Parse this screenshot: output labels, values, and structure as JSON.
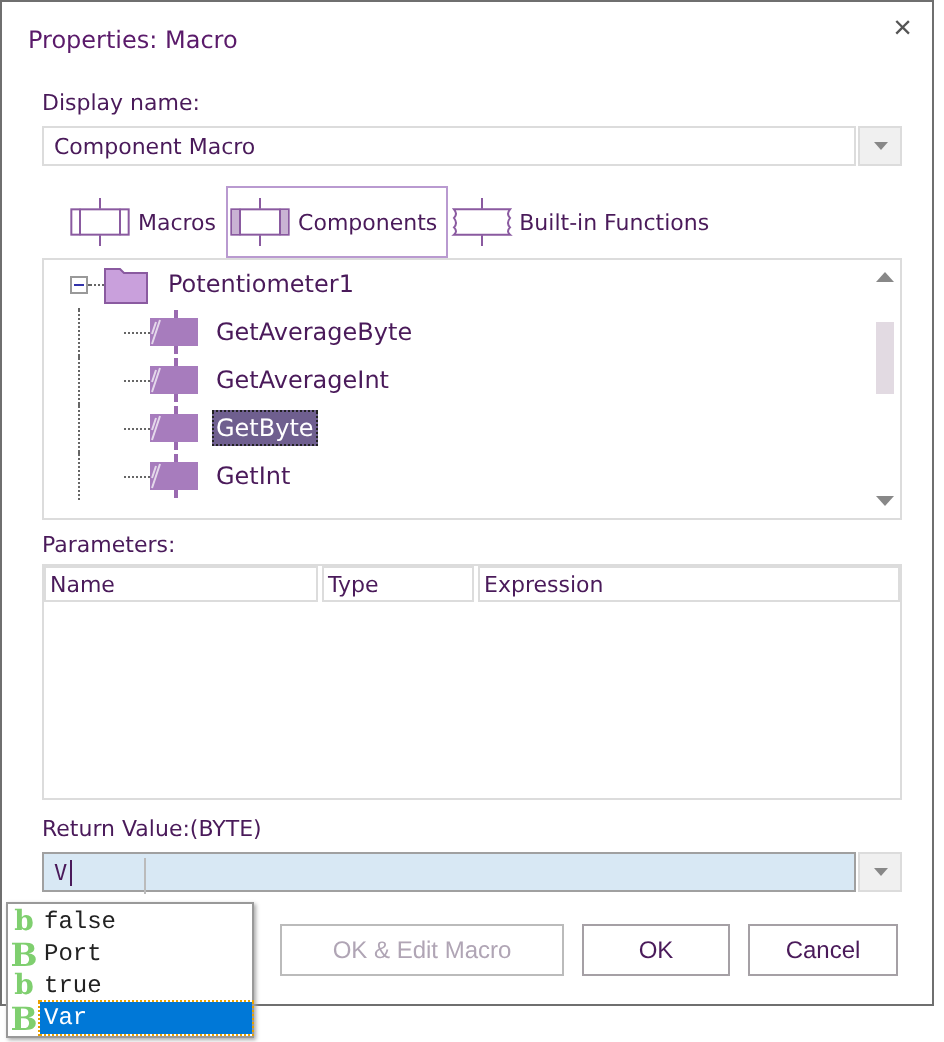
{
  "window": {
    "title": "Properties: Macro",
    "close": "×"
  },
  "display_name": {
    "label": "Display name:",
    "value": "Component Macro"
  },
  "tabs": [
    {
      "label": "Macros",
      "kind": "macros",
      "selected": false
    },
    {
      "label": "Components",
      "kind": "components",
      "selected": true
    },
    {
      "label": "Built-in Functions",
      "kind": "builtin",
      "selected": false
    }
  ],
  "tree": [
    {
      "label": "Potentiometer1",
      "expanded": true,
      "selected": false,
      "children": [
        {
          "label": "GetAverageByte",
          "selected": false
        },
        {
          "label": "GetAverageInt",
          "selected": false
        },
        {
          "label": "GetByte",
          "selected": true
        },
        {
          "label": "GetInt",
          "selected": false
        }
      ]
    }
  ],
  "parameters": {
    "label": "Parameters:",
    "columns": [
      "Name",
      "Type",
      "Expression"
    ]
  },
  "return_value": {
    "label": "Return Value:(BYTE)",
    "value": "V"
  },
  "buttons": [
    {
      "label": "OK & Edit Macro",
      "disabled": true
    },
    {
      "label": "OK",
      "disabled": false
    },
    {
      "label": "Cancel",
      "disabled": false
    }
  ],
  "suggestions": [
    {
      "glyph": "b",
      "kind": "bool",
      "label": "false",
      "selected": false
    },
    {
      "glyph": "B",
      "kind": "byte",
      "label": "Port",
      "selected": false
    },
    {
      "glyph": "b",
      "kind": "bool",
      "label": "true",
      "selected": false
    },
    {
      "glyph": "B",
      "kind": "byte",
      "label": "Var",
      "selected": true
    }
  ]
}
